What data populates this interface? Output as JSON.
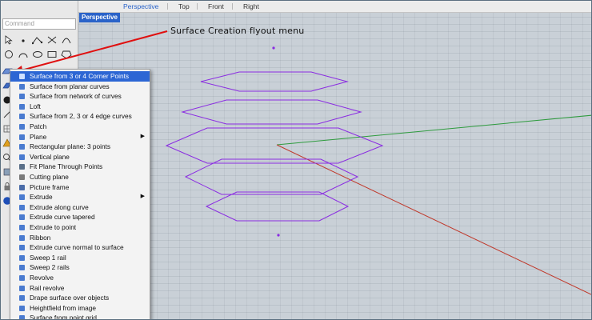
{
  "tabs": {
    "perspective": "Perspective",
    "top": "Top",
    "front": "Front",
    "right": "Right"
  },
  "command": {
    "placeholder": "Command"
  },
  "viewport_label": "Perspective",
  "annotation": "Surface Creation flyout menu",
  "menu": {
    "items": [
      {
        "label": "Surface from 3 or 4 Corner Points",
        "submenu": false,
        "selected": true
      },
      {
        "label": "Surface from planar curves",
        "submenu": false
      },
      {
        "label": "Surface from network of curves",
        "submenu": false
      },
      {
        "label": "Loft",
        "submenu": false
      },
      {
        "label": "Surface from 2, 3 or 4 edge curves",
        "submenu": false
      },
      {
        "label": "Patch",
        "submenu": false
      },
      {
        "label": "Plane",
        "submenu": true
      },
      {
        "label": "Rectangular plane: 3 points",
        "submenu": false
      },
      {
        "label": "Vertical plane",
        "submenu": false
      },
      {
        "label": "Fit Plane Through Points",
        "submenu": false
      },
      {
        "label": "Cutting plane",
        "submenu": false
      },
      {
        "label": "Picture frame",
        "submenu": false
      },
      {
        "label": "Extrude",
        "submenu": true
      },
      {
        "label": "Extrude along curve",
        "submenu": false
      },
      {
        "label": "Extrude curve tapered",
        "submenu": false
      },
      {
        "label": "Extrude to point",
        "submenu": false
      },
      {
        "label": "Ribbon",
        "submenu": false
      },
      {
        "label": "Extrude curve normal to surface",
        "submenu": false
      },
      {
        "label": "Sweep 1 rail",
        "submenu": false
      },
      {
        "label": "Sweep 2 rails",
        "submenu": false
      },
      {
        "label": "Revolve",
        "submenu": false
      },
      {
        "label": "Rail revolve",
        "submenu": false
      },
      {
        "label": "Drape surface over objects",
        "submenu": false
      },
      {
        "label": "Heightfield from image",
        "submenu": false
      },
      {
        "label": "Surface from point grid",
        "submenu": false
      }
    ]
  },
  "colors": {
    "accent": "#2c66d4",
    "curves": "#8a2be2",
    "x_axis": "#c0392b",
    "y_axis": "#2e9b3e",
    "arrow": "#e01010"
  },
  "icons": [
    "select-arrow-icon",
    "point-icon",
    "polyline-icon",
    "line-icon",
    "circle-icon",
    "arc-icon",
    "curve-icon",
    "surface-icon"
  ]
}
